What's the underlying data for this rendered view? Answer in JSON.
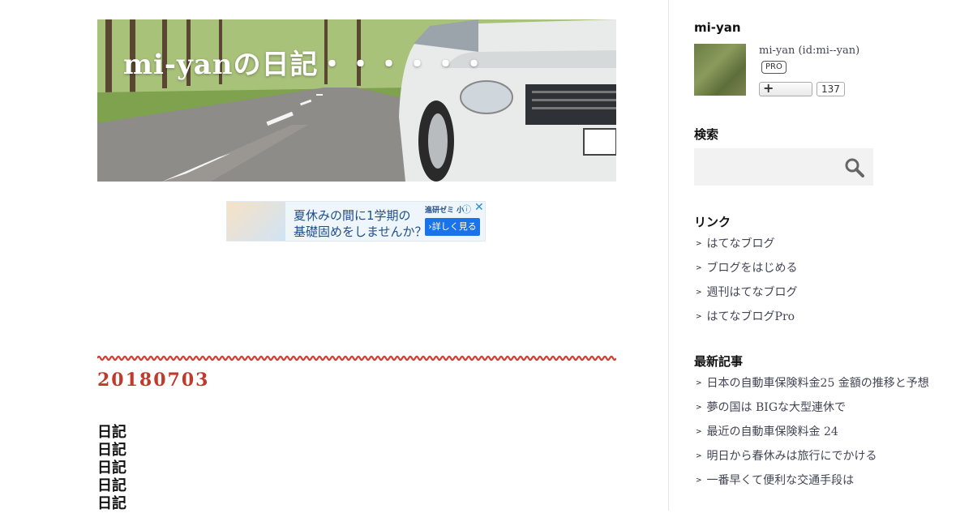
{
  "header": {
    "blog_title": "mi-yanの日記・・・・・・"
  },
  "ad": {
    "line1": "夏休みの間に1学期の",
    "line2": "基礎固めをしませんか？",
    "brand": "進研ゼミ 小",
    "cta_label": "›詳しく見る",
    "info_icon": "info-icon",
    "close_icon": "close-icon"
  },
  "entry": {
    "date_title": "20180703",
    "lines": [
      "日記",
      "日記",
      "日記",
      "日記",
      "日記"
    ]
  },
  "sidebar": {
    "profile": {
      "title": "mi-yan",
      "name": "mi-yan (id:mi--yan)",
      "badge": "PRO",
      "follow_icon": "+",
      "follower_count": "137"
    },
    "search": {
      "title": "検索",
      "placeholder": ""
    },
    "links": {
      "title": "リンク",
      "items": [
        "はてなブログ",
        "ブログをはじめる",
        "週刊はてなブログ",
        "はてなブログPro"
      ]
    },
    "recent": {
      "title": "最新記事",
      "items": [
        "日本の自動車保険料金25 金額の推移と予想",
        "夢の国は BIGな大型連休で",
        "最近の自動車保険料金 24",
        "明日から春休みは旅行にでかける",
        "一番早くて便利な交通手段は"
      ]
    }
  },
  "colors": {
    "accent_red": "#c0392b",
    "link": "#445566"
  }
}
